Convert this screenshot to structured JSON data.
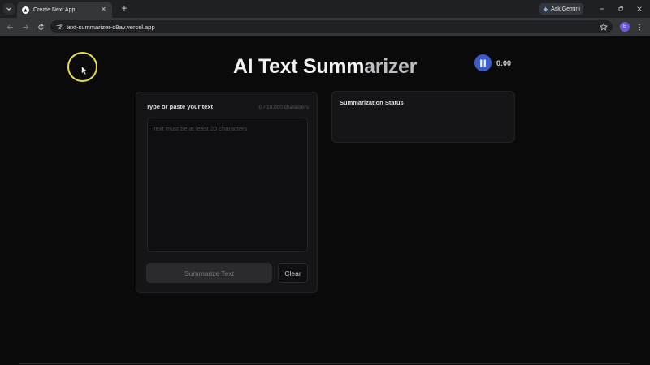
{
  "browser": {
    "tab": {
      "title": "Create Next App"
    },
    "gemini_label": "Ask Gemini",
    "url": "text-summarizer-o9av.vercel.app",
    "profile_initial": "E"
  },
  "page": {
    "title_part1": "AI Text Summ",
    "title_part2": "arizer"
  },
  "recorder": {
    "time": "0:00"
  },
  "input_card": {
    "label": "Type or paste your text",
    "char_count": "0 / 10,000 characters",
    "placeholder": "Text must be at least 20 characters",
    "summarize_label": "Summarize Text",
    "clear_label": "Clear"
  },
  "status_card": {
    "title": "Summarization Status"
  },
  "colors": {
    "background": "#0a0a0b",
    "card": "#151517",
    "accent_pause": "#3b5ccc",
    "highlight_ring": "#e6e040"
  }
}
